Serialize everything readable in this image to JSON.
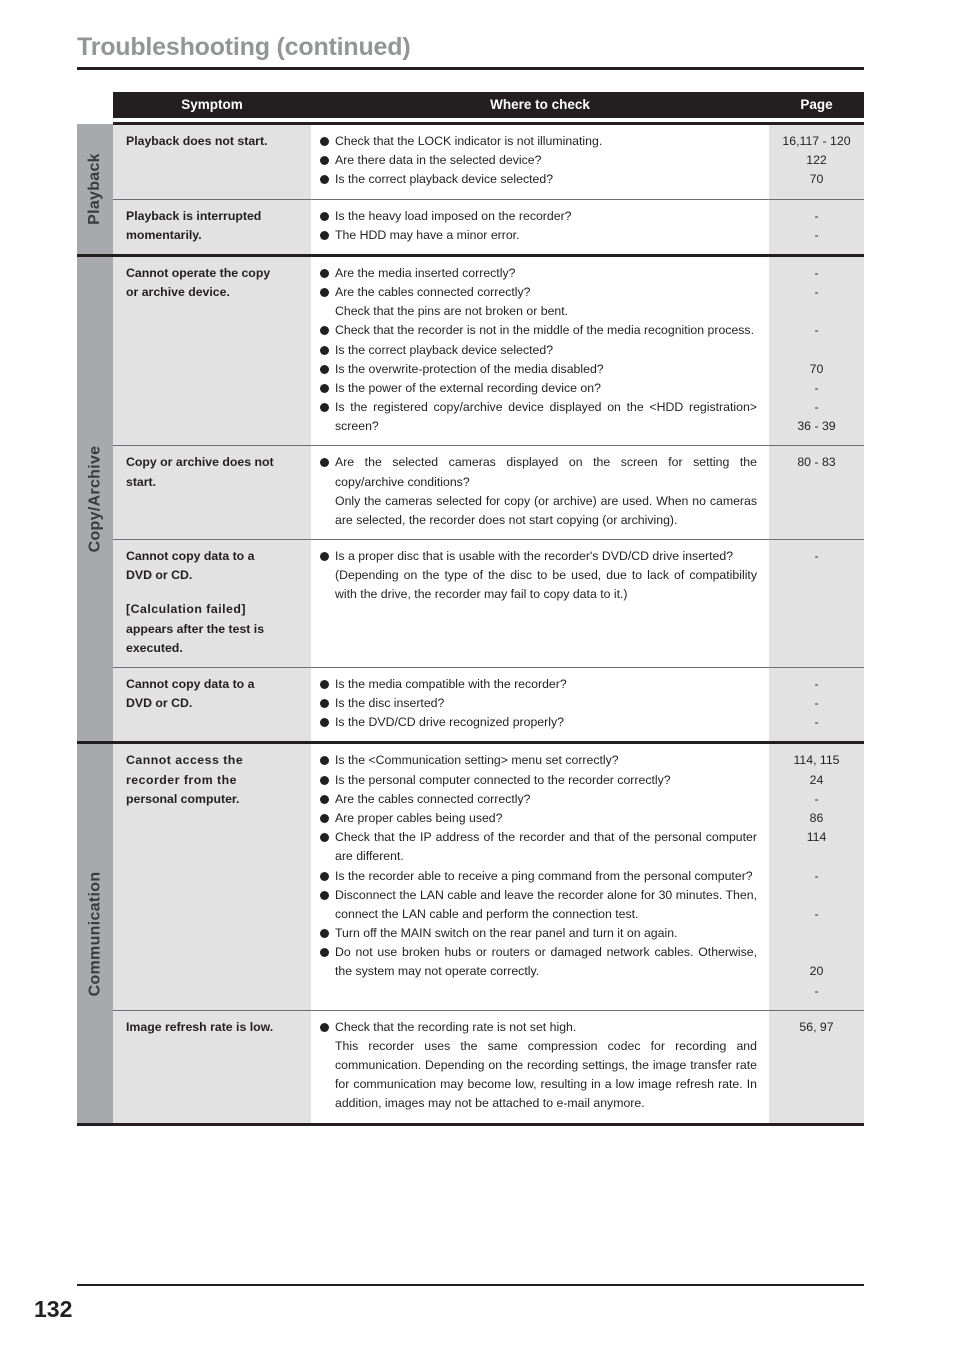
{
  "document": {
    "title": "Troubleshooting (continued)",
    "page_number": "132"
  },
  "table": {
    "headers": {
      "symptom": "Symptom",
      "where_to_check": "Where to check",
      "page": "Page"
    },
    "sections": [
      {
        "label": "Playback",
        "rows": [
          {
            "symptom_lines": [
              "Playback does not start."
            ],
            "checks": [
              {
                "bullet": true,
                "text": "Check that the LOCK indicator is not illuminating."
              },
              {
                "bullet": true,
                "text": "Are there data in the selected device?"
              },
              {
                "bullet": true,
                "text": "Is the correct playback device selected?"
              }
            ],
            "pages": [
              "16,117 - 120",
              "122",
              "70"
            ]
          },
          {
            "symptom_lines": [
              "Playback is interrupted",
              "momentarily."
            ],
            "checks": [
              {
                "bullet": true,
                "text": "Is the heavy load imposed on the recorder?"
              },
              {
                "bullet": true,
                "text": "The HDD may have a minor error."
              }
            ],
            "pages": [
              "-",
              "-"
            ]
          }
        ]
      },
      {
        "label": "Copy/Archive",
        "rows": [
          {
            "symptom_lines": [
              "Cannot operate the copy",
              "or archive device."
            ],
            "checks": [
              {
                "bullet": true,
                "text": "Are the media inserted correctly?"
              },
              {
                "bullet": true,
                "text": "Are the cables connected correctly?",
                "sub": "Check that the pins are not broken or bent."
              },
              {
                "bullet": true,
                "text": "Check that the recorder is not in the middle of the media recognition process."
              },
              {
                "bullet": true,
                "text": "Is the correct playback device selected?"
              },
              {
                "bullet": true,
                "text": "Is the overwrite-protection of the media disabled?"
              },
              {
                "bullet": true,
                "text": "Is the power of the external recording device on?"
              },
              {
                "bullet": true,
                "text": "Is the registered copy/archive device displayed on the <HDD registration> screen?"
              }
            ],
            "pages": [
              "-",
              "-",
              "",
              "-",
              "",
              "70",
              "-",
              "-",
              "36 - 39"
            ]
          },
          {
            "symptom_lines": [
              "Copy or archive does not",
              "start."
            ],
            "checks": [
              {
                "bullet": true,
                "text": "Are the selected cameras displayed on the screen for setting the copy/archive conditions?",
                "sub": "Only the cameras selected for copy (or archive) are used. When no cameras are selected, the recorder does not start copying (or archiving)."
              }
            ],
            "pages": [
              "80 - 83"
            ]
          },
          {
            "symptom_lines": [
              "Cannot copy data to a",
              "DVD or CD."
            ],
            "symptom_extra_lines": [
              "[Calculation failed]",
              "appears after the test is",
              "executed."
            ],
            "checks": [
              {
                "bullet": true,
                "text": "Is a proper disc that is usable with the recorder's DVD/CD drive inserted?",
                "sub": "(Depending on the type of the disc to be used, due to lack of compatibility with the drive, the recorder may fail to copy data to it.)"
              }
            ],
            "pages": [
              "-"
            ]
          },
          {
            "symptom_lines": [
              "Cannot copy data to a",
              "DVD or CD."
            ],
            "checks": [
              {
                "bullet": true,
                "text": "Is the media compatible with the recorder?"
              },
              {
                "bullet": true,
                "text": "Is the disc inserted?"
              },
              {
                "bullet": true,
                "text": "Is the DVD/CD drive recognized properly?"
              }
            ],
            "pages": [
              "-",
              "-",
              "-"
            ]
          }
        ]
      },
      {
        "label": "Communication",
        "rows": [
          {
            "symptom_lines": [
              "Cannot access the",
              "recorder from the",
              "personal computer."
            ],
            "checks": [
              {
                "bullet": true,
                "text": "Is the <Communication setting> menu set correctly?"
              },
              {
                "bullet": true,
                "text": "Is the personal computer connected to the recorder correctly?"
              },
              {
                "bullet": true,
                "text": "Are the cables connected correctly?"
              },
              {
                "bullet": true,
                "text": "Are proper cables being used?"
              },
              {
                "bullet": true,
                "text": "Check that the IP address of the recorder and that of the personal computer are different."
              },
              {
                "bullet": true,
                "text": "Is the recorder able to receive a ping command from the personal computer?"
              },
              {
                "bullet": true,
                "text": "Disconnect the LAN cable and leave the recorder alone for 30 minutes. Then, connect the LAN cable and perform the connection test."
              },
              {
                "bullet": true,
                "text": "Turn off the MAIN switch on the rear panel and turn it on again."
              },
              {
                "bullet": true,
                "text": "Do not use broken hubs or routers or damaged network cables. Otherwise, the system may not operate correctly."
              }
            ],
            "pages": [
              "114, 115",
              "24",
              "-",
              "86",
              "114",
              "",
              "-",
              "",
              "",
              "-",
              "",
              "",
              "20",
              "-"
            ]
          },
          {
            "symptom_lines": [
              "Image refresh rate is low."
            ],
            "checks": [
              {
                "bullet": true,
                "text": "Check that the recording rate is not set high.",
                "sub": "This recorder uses the same compression codec for recording and communication. Depending on the recording settings, the image transfer rate for communication may become low, resulting in a low image refresh rate. In addition, images may not be attached to e-mail anymore."
              }
            ],
            "pages": [
              "56, 97"
            ]
          }
        ]
      }
    ]
  },
  "colors": {
    "header_bg": "#231f20",
    "side_bg": "#a7a9ac",
    "symptom_bg": "#e2e2e2",
    "page_bg": "#e2e2e2",
    "title_gray": "#939598"
  }
}
